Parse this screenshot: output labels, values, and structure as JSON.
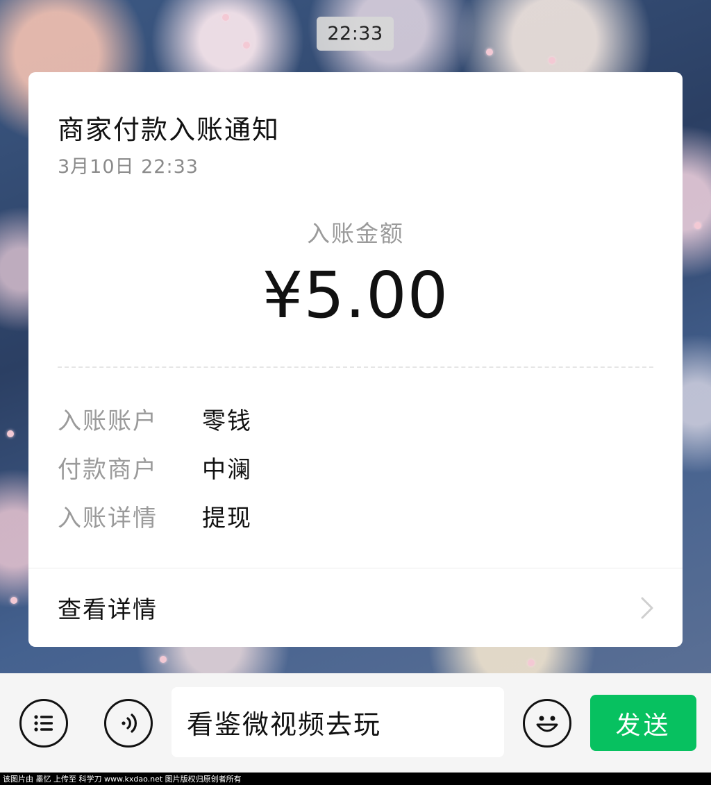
{
  "status": {
    "time": "22:33"
  },
  "notification": {
    "title": "商家付款入账通知",
    "date": "3月10日  22:33",
    "amount_label": "入账金额",
    "amount": "¥5.00",
    "details": [
      {
        "key": "入账账户",
        "value": "零钱"
      },
      {
        "key": "付款商户",
        "value": "中澜"
      },
      {
        "key": "入账详情",
        "value": "提现"
      }
    ],
    "view_details_label": "查看详情"
  },
  "input_bar": {
    "menu_icon": "list-icon",
    "voice_icon": "voice-icon",
    "text_value": "看鉴微视频去玩",
    "emoji_icon": "emoji-icon",
    "send_label": "发送"
  },
  "colors": {
    "send_button": "#07c160",
    "card_bg": "#ffffff",
    "muted_text": "#9a9a9a"
  },
  "watermark": "该图片由 墨忆 上传至 科学刀 www.kxdao.net 图片版权归原创者所有"
}
